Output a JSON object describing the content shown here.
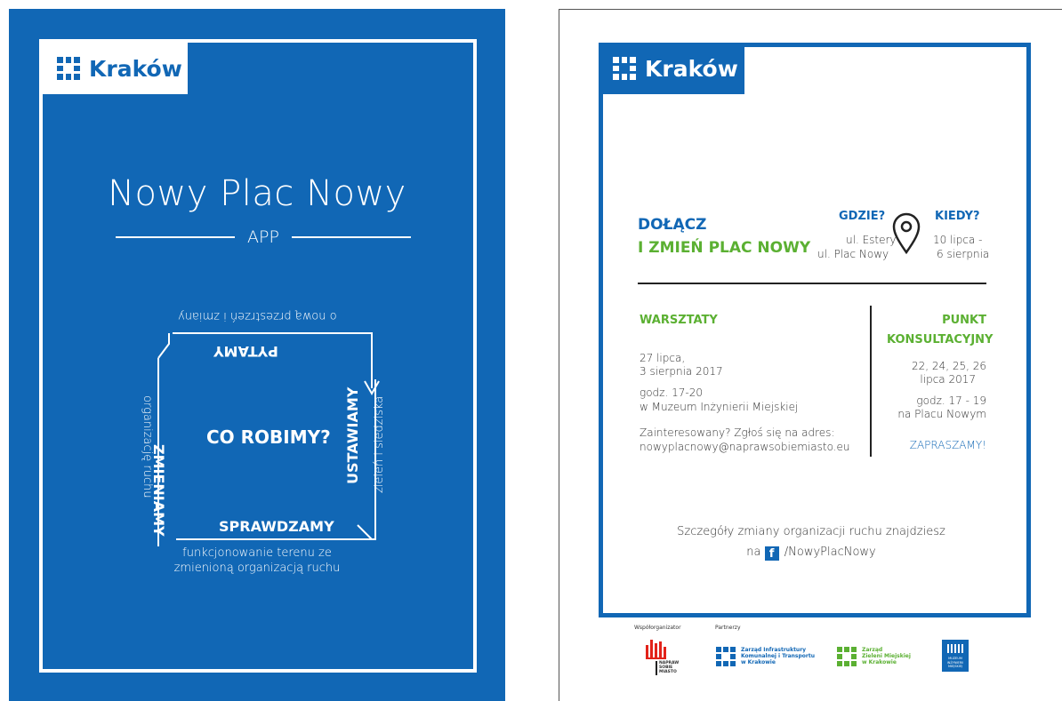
{
  "left_poster": {
    "logo_text": "Kraków",
    "title": "Nowy Plac Nowy",
    "subtitle": "APP",
    "center": "CO ROBIMY?",
    "top_word": "PYTAMY",
    "top_note": "o nową przestrzeń i zmiany",
    "left_word": "ZMIENIAMY",
    "left_note": "organizację ruchu",
    "right_word": "USTAWIAMY",
    "right_note": "zieleń i siedziska",
    "bottom_word": "SPRAWDZAMY",
    "bottom_note_1": "funkcjonowanie terenu ze",
    "bottom_note_2": "zmienioną organizacją ruchu"
  },
  "right_poster": {
    "logo_text": "Kraków",
    "join_1": "DOŁĄCZ",
    "join_2": "I ZMIEŃ PLAC NOWY",
    "where_label": "GDZIE?",
    "where_1": "ul. Estery",
    "where_2": "ul. Plac Nowy",
    "when_label": "KIEDY?",
    "when_1": "10 lipca -",
    "when_2": "6 sierpnia",
    "workshops_label": "WARSZTATY",
    "ws_date_1": "27 lipca,",
    "ws_date_2": "3 sierpnia 2017",
    "ws_time": "godz. 17-20",
    "ws_place": "w Muzeum Inżynierii Miejskiej",
    "ws_signup": "Zainteresowany? Zgłoś się na adres:",
    "ws_email": "nowyplacnowy@naprawsobiemiasto.eu",
    "point_label_1": "PUNKT",
    "point_label_2": "KONSULTACYJNY",
    "pt_dates_1": "22, 24, 25, 26",
    "pt_dates_2": "lipca 2017",
    "pt_time": "godz. 17 - 19",
    "pt_place": "na Placu Nowym",
    "invite": "ZAPRASZAMY!",
    "details": "Szczegóły zmiany organizacji ruchu znajdziesz",
    "details_prefix": "na",
    "fb_icon_letter": "f",
    "fb_handle": "/NowyPlacNowy",
    "coorganizer_label": "Współorganizator",
    "partners_label": "Partnerzy",
    "org_naprawsobie": "NAPRAW SOBIE MIASTO",
    "org_zikit": "Zarząd Infrastruktury Komunalnej i Transportu w Krakowie",
    "org_zikit_1": "Zarząd Infrastruktury",
    "org_zikit_2": "Komunalnej i Transportu",
    "org_zikit_3": "w Krakowie",
    "org_zzm_1": "Zarząd",
    "org_zzm_2": "Zieleni Miejskiej",
    "org_zzm_3": "w Krakowie",
    "org_muzeum": "MUZEUM INŻYNIERII MIEJSKIEJ"
  },
  "colors": {
    "brand_blue": "#1167b5",
    "green": "#5bb032"
  },
  "icons": [
    "krakow-logo-icon",
    "map-pin-icon",
    "facebook-icon"
  ]
}
